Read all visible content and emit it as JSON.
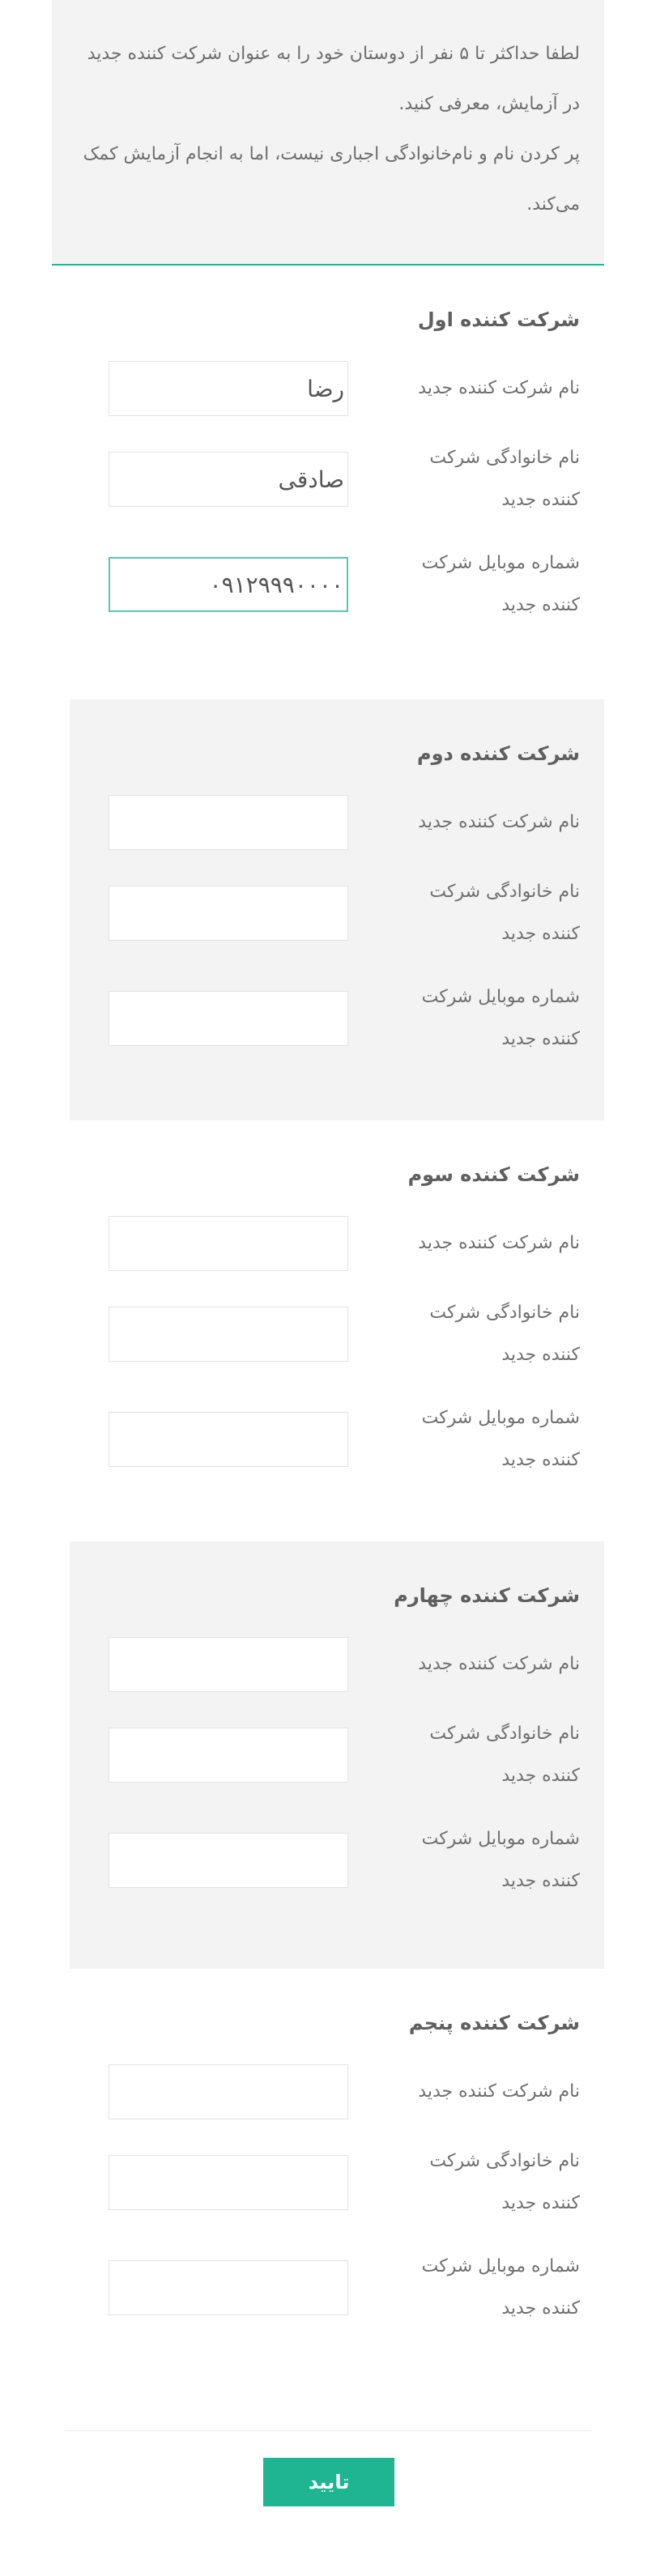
{
  "intro": {
    "line1": "لطفا حداکثر تا ۵ نفر از دوستان خود را به عنوان شرکت کننده جدید",
    "line2": "در آزمایش، معرفی کنید.",
    "line3": "پر کردن نام و نام‌خانوادگی اجباری نیست، اما به انجام آزمایش کمک",
    "line4": "می‌کند."
  },
  "labels": {
    "first_name": "نام شرکت کننده جدید",
    "last_name": "نام خانوادگی شرکت کننده جدید",
    "mobile": "شماره موبایل شرکت کننده جدید"
  },
  "participants": [
    {
      "title": "شرکت کننده اول",
      "first_name": "رضا",
      "last_name": "صادقی",
      "mobile": "۰۹۱۲۹۹۹۰۰۰۰"
    },
    {
      "title": "شرکت کننده دوم",
      "first_name": "",
      "last_name": "",
      "mobile": ""
    },
    {
      "title": "شرکت کننده سوم",
      "first_name": "",
      "last_name": "",
      "mobile": ""
    },
    {
      "title": "شرکت کننده چهارم",
      "first_name": "",
      "last_name": "",
      "mobile": ""
    },
    {
      "title": "شرکت کننده پنجم",
      "first_name": "",
      "last_name": "",
      "mobile": ""
    }
  ],
  "submit_label": "تایید",
  "colors": {
    "accent": "#1fb592",
    "shaded_bg": "#f3f3f3"
  }
}
